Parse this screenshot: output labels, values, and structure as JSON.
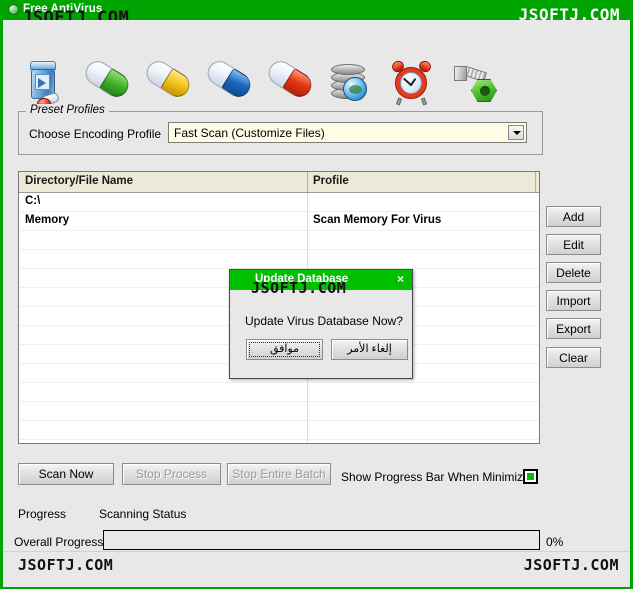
{
  "window": {
    "title": "Free AntiVirus",
    "icon": "pill-icon",
    "accent_color": "#00a400",
    "background_color": "#e8e8e8"
  },
  "watermarks": {
    "top_left": "JSOFTJ.COM",
    "top_right": "JSOFTJ.COM",
    "dialog": "JSOFTJ.COM",
    "bottom_left": "JSOFTJ.COM",
    "bottom_right": "JSOFTJ.COM"
  },
  "toolbar": {
    "items": [
      {
        "icon": "pill-bottle-icon",
        "name": "pill-bottle"
      },
      {
        "icon": "capsule-green-icon",
        "name": "capsule-green"
      },
      {
        "icon": "capsule-yellow-icon",
        "name": "capsule-yellow"
      },
      {
        "icon": "capsule-blue-icon",
        "name": "capsule-blue"
      },
      {
        "icon": "capsule-red-icon",
        "name": "capsule-red"
      },
      {
        "icon": "database-globe-icon",
        "name": "database-update"
      },
      {
        "icon": "alarm-clock-icon",
        "name": "scheduler"
      },
      {
        "icon": "bolt-nut-icon",
        "name": "settings"
      }
    ]
  },
  "preset_profiles": {
    "group_title": "Preset Profiles",
    "label": "Choose Encoding Profile",
    "selected": "Fast Scan (Customize Files)",
    "options": [
      "Fast Scan (Customize Files)"
    ]
  },
  "list": {
    "columns": [
      "Directory/File Name",
      "Profile"
    ],
    "rows": [
      {
        "name": "C:\\",
        "profile": ""
      },
      {
        "name": "Memory",
        "profile": "Scan Memory For Virus"
      }
    ],
    "empty_row_count": 12
  },
  "side_buttons": [
    {
      "label": "Add"
    },
    {
      "label": "Edit"
    },
    {
      "label": "Delete"
    },
    {
      "label": "Import"
    },
    {
      "label": "Export"
    },
    {
      "label": "Clear"
    }
  ],
  "actions": {
    "scan_now": "Scan Now",
    "stop_process": "Stop Process",
    "stop_entire_batch": "Stop Entire Batch",
    "show_progress_label": "Show Progress Bar When Minimized",
    "show_progress_checked": true,
    "checkbox_color": "#00c000"
  },
  "progress": {
    "label": "Progress",
    "status": "Scanning Status",
    "overall_label": "Overall Progress",
    "percent_text": "0%",
    "percent_value": 0
  },
  "dialog": {
    "title": "Update Database",
    "close_icon": "close-icon",
    "close_glyph": "×",
    "message": "Update Virus Database Now?",
    "ok_label": "موافق",
    "cancel_label": "إلغاء الأمر",
    "title_color": "#00c000"
  }
}
